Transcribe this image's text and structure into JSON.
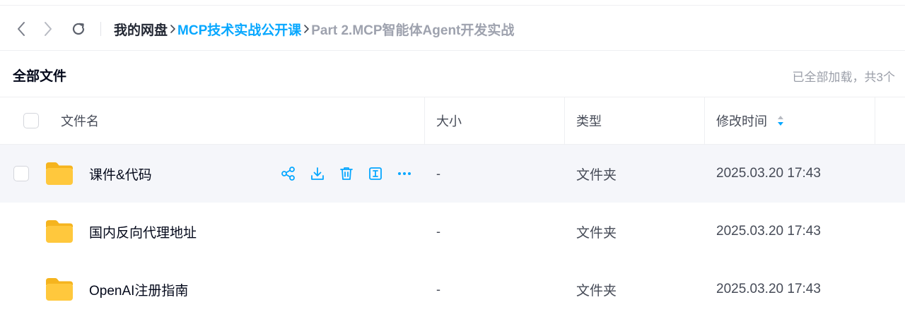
{
  "nav": {
    "back_icon": "chevron-left-icon",
    "forward_icon": "chevron-right-icon",
    "refresh_icon": "refresh-icon"
  },
  "breadcrumb": {
    "root": "我的网盘",
    "folder": "MCP技术实战公开课",
    "current": "Part 2.MCP智能体Agent开发实战"
  },
  "header": {
    "title": "全部文件",
    "status": "已全部加载，共3个"
  },
  "table": {
    "columns": {
      "name": "文件名",
      "size": "大小",
      "type": "类型",
      "modified": "修改时间"
    },
    "rows": [
      {
        "name": "课件&代码",
        "size": "-",
        "type": "文件夹",
        "modified": "2025.03.20 17:43"
      },
      {
        "name": "国内反向代理地址",
        "size": "-",
        "type": "文件夹",
        "modified": "2025.03.20 17:43"
      },
      {
        "name": "OpenAI注册指南",
        "size": "-",
        "type": "文件夹",
        "modified": "2025.03.20 17:43"
      }
    ],
    "row_actions": [
      "share-icon",
      "download-icon",
      "delete-icon",
      "rename-icon",
      "more-icon"
    ]
  },
  "colors": {
    "accent": "#06a7ff",
    "folder": "#ffc83d",
    "hover_row": "#f5f6fa",
    "muted_text": "#9ea2ae"
  }
}
